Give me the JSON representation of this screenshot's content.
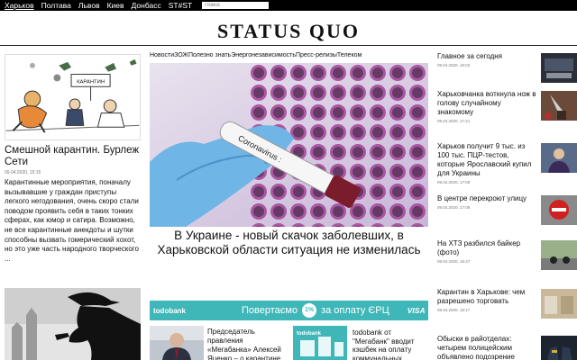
{
  "topnav": {
    "items": [
      "Харьков",
      "Полтава",
      "Львов",
      "Киев",
      "Донбасс",
      "ST#ST"
    ],
    "search_placeholder": "Поиск"
  },
  "logo": "STATUS QUO",
  "left": {
    "title": "Смешной карантин. Бурлеж Сети",
    "date": "09.04.2020, 15:15",
    "text": "Карантинные мероприятия, поначалу вызывавшие у граждан приступы легкого негодования, очень скоро стали поводом проявить себя в таких тонких сферах, как юмор и сатира. Возможно, не все карантинные анекдоты и шутки способны вызвать гомерический хохот, но это уже часть народного творческого ...",
    "cartoon_sign": "КАРАНТИН"
  },
  "center": {
    "nav": [
      "Новости",
      "ЗОЖ",
      "Полезно знать",
      "Энергонезависимость",
      "Пресс-релизы",
      "Телеком"
    ],
    "hero_tube_label": "Coronavirus :",
    "hero_title": "В Украине - новый скачок заболевших, в Харьковской области ситуация не изменилась",
    "banner": {
      "brand": "todobank",
      "slogan_left": "Повертаємо",
      "pct": "1%",
      "slogan_right": "за оплату ЄРЦ",
      "card": "VISA",
      "color": "#3fb7b9"
    },
    "sub1": "Председатель правления «Мегабанка» Алексей Яценко – о карантине,",
    "sub2": "todobank от \"Мегабанк\" вводит кэшбек на оплату коммунальных",
    "sub2_img_brand": "todobank"
  },
  "right": {
    "items": [
      {
        "title": "Главное за сегодня",
        "date": "09.04.2020, 18:02"
      },
      {
        "title": "Харьковчанка воткнула нож в голову случайному знакомому",
        "date": "09.04.2020, 17:21"
      },
      {
        "title": "Харьков получит 9 тыс. из 100 тыс. ПЦР-тестов, которые Ярославский купил для Украины",
        "date": "09.04.2020, 17:09"
      },
      {
        "title": "В центре перекроют улицу",
        "date": "09.04.2020, 17:06"
      },
      {
        "title": "На ХТЗ разбился байкер (фото)",
        "date": "09.04.2020, 16:47"
      },
      {
        "title": "Карантин в Харькове: чем разрешено торговать",
        "date": "09.04.2020, 16:17"
      },
      {
        "title": "Обыски в райотделах: четырем полицейским объявлено подозрение",
        "date": ""
      }
    ]
  }
}
